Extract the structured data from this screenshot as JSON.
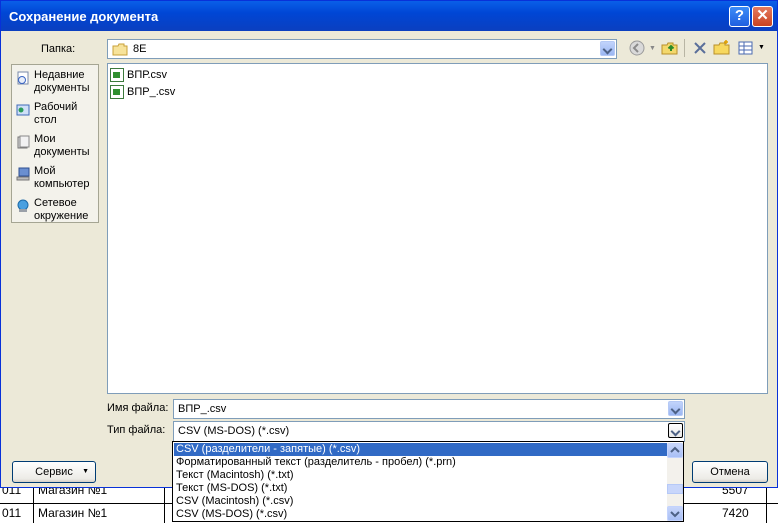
{
  "dialog": {
    "title": "Сохранение документа",
    "help_glyph": "?",
    "close_glyph": "✕"
  },
  "folder": {
    "label": "Папка:",
    "value": "8E",
    "icon": "folder-icon"
  },
  "toolbar": {
    "icons": [
      "back-icon",
      "up-folder-icon",
      "delete-icon",
      "new-folder-icon",
      "views-icon"
    ]
  },
  "places": [
    {
      "label": "Недавние документы",
      "icon": "recent-documents-icon"
    },
    {
      "label": "Рабочий стол",
      "icon": "desktop-icon"
    },
    {
      "label": "Мои документы",
      "icon": "my-documents-icon"
    },
    {
      "label": "Мой компьютер",
      "icon": "my-computer-icon"
    },
    {
      "label": "Сетевое окружение",
      "icon": "network-icon"
    }
  ],
  "files": [
    {
      "name": "ВПР.csv",
      "icon": "csv-file-icon"
    },
    {
      "name": "ВПР_.csv",
      "icon": "csv-file-icon"
    }
  ],
  "filename": {
    "label": "Имя файла:",
    "value": "ВПР_.csv"
  },
  "filetype": {
    "label": "Тип файла:",
    "value": "CSV (MS-DOS) (*.csv)",
    "options": [
      "CSV (разделители - запятые) (*.csv)",
      "Форматированный текст (разделитель - пробел) (*.prn)",
      "Текст (Macintosh) (*.txt)",
      "Текст (MS-DOS) (*.txt)",
      "CSV (Macintosh) (*.csv)",
      "CSV (MS-DOS) (*.csv)"
    ],
    "highlighted_index": 0
  },
  "buttons": {
    "service": "Сервис",
    "cancel": "Отмена"
  },
  "background_sheet": {
    "rows": [
      {
        "date": "011",
        "store": "Магазин №1",
        "value": "5507"
      },
      {
        "date": "011",
        "store": "Магазин №1",
        "value": "7420"
      }
    ]
  },
  "colors": {
    "titlebar": "#0046d5",
    "dialog_bg": "#ece9d8",
    "selection": "#316ac5"
  }
}
